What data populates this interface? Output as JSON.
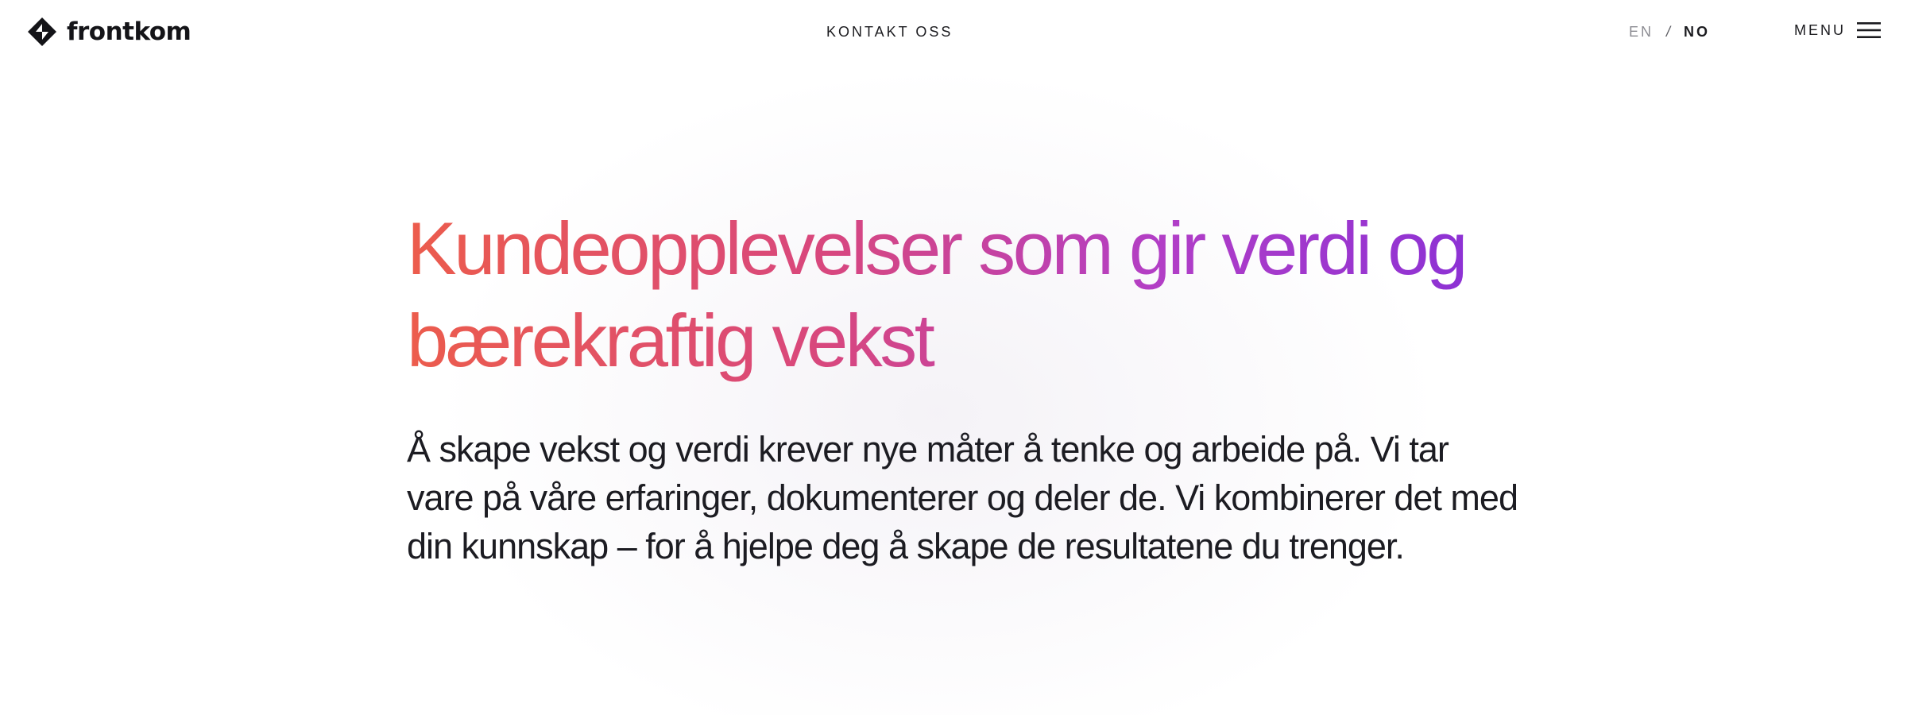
{
  "header": {
    "logo_text": "frontkom",
    "logo_icon": "frontkom-diamond-logo-icon",
    "contact_label": "KONTAKT OSS",
    "lang_en": "EN",
    "lang_separator": "/",
    "lang_no": "NO",
    "menu_label": "MENU",
    "menu_icon": "hamburger-icon"
  },
  "hero": {
    "title": "Kundeopplevelser som gir verdi og bærekraftig vekst",
    "body": "Å skape vekst og verdi krever nye måter å tenke og arbeide på. Vi tar vare på våre erfaringer, dokumenterer og deler de. Vi kombinerer det med din kunnskap – for å hjelpe deg å skape de resultatene du trenger."
  },
  "colors": {
    "gradient_start": "#ec5c4c",
    "gradient_mid": "#d8477e",
    "gradient_end": "#8830d6",
    "text_dark": "#1b1b1f",
    "text_muted": "#8c8c92"
  }
}
